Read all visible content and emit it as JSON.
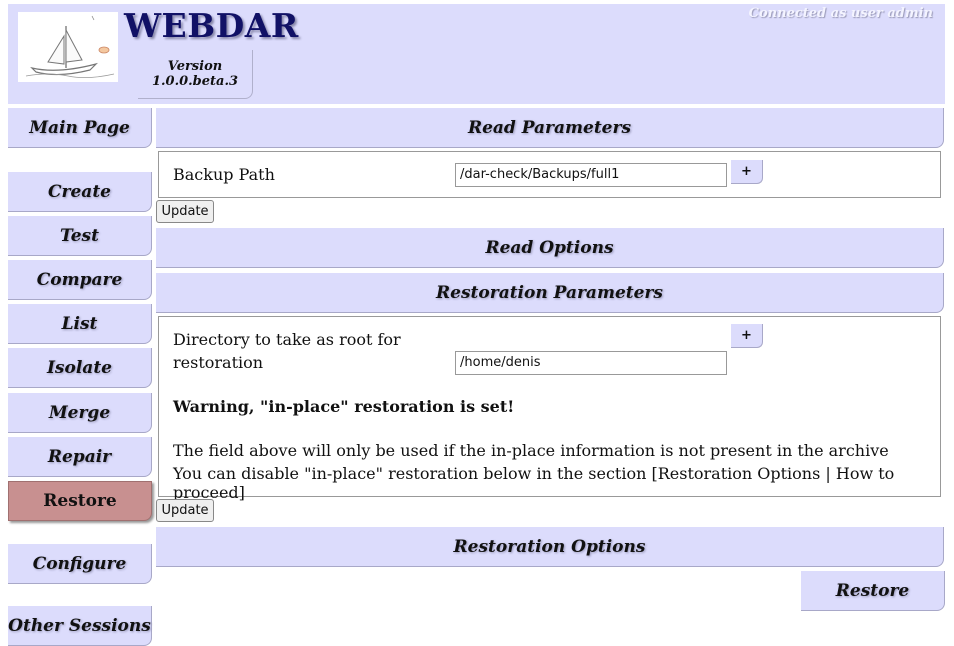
{
  "header": {
    "title": "WEBDAR",
    "version_label": "Version",
    "version_number": "1.0.0.beta.3",
    "connected": "Connected as user admin"
  },
  "sidebar": {
    "items": [
      {
        "label": "Main Page"
      },
      {
        "label": "Create"
      },
      {
        "label": "Test"
      },
      {
        "label": "Compare"
      },
      {
        "label": "List"
      },
      {
        "label": "Isolate"
      },
      {
        "label": "Merge"
      },
      {
        "label": "Repair"
      },
      {
        "label": "Restore",
        "active": true
      },
      {
        "label": "Configure"
      },
      {
        "label": "Other Sessions"
      }
    ]
  },
  "main": {
    "read_parameters": {
      "title": "Read Parameters",
      "backup_path_label": "Backup Path",
      "backup_path_value": "/dar-check/Backups/full1",
      "plus_label": "+",
      "update_label": "Update"
    },
    "read_options": {
      "title": "Read Options"
    },
    "restoration_parameters": {
      "title": "Restoration Parameters",
      "root_label_line1": "Directory to take as root for",
      "root_label_line2": "restoration",
      "root_value": "/home/denis",
      "plus_label": "+",
      "warning": "Warning, \"in-place\" restoration is set!",
      "info_line1": "The field above will only be used if the in-place information is not present in the archive",
      "info_line2": "You can disable \"in-place\" restoration below in the section [Restoration Options | How to proceed]",
      "update_label": "Update"
    },
    "restoration_options": {
      "title": "Restoration Options"
    },
    "restore_button": "Restore"
  },
  "colors": {
    "panel_bg": "#dcdcfc",
    "active_nav": "#c89090",
    "title_color": "#111166"
  }
}
